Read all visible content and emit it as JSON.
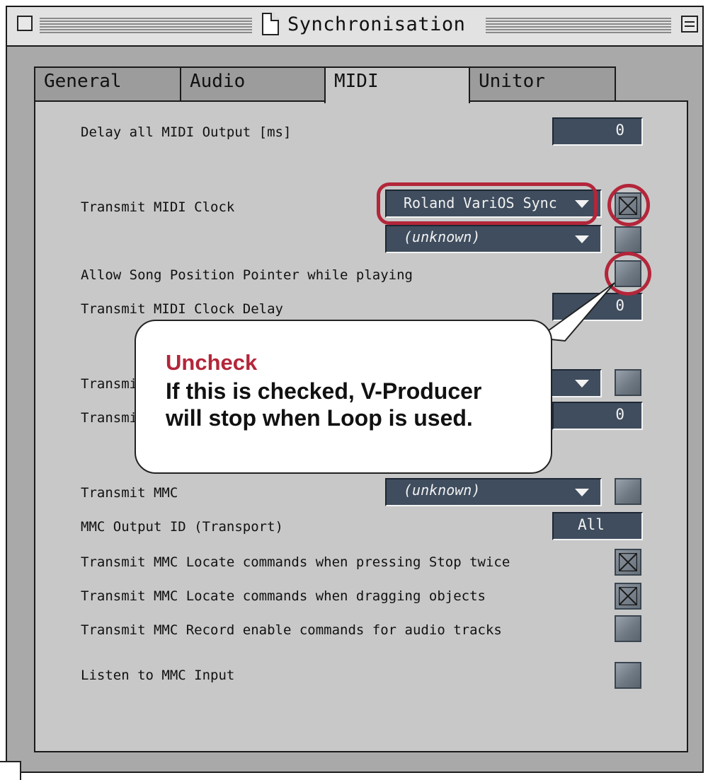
{
  "window": {
    "title": "Synchronisation"
  },
  "tabs": [
    {
      "label": "General",
      "active": false
    },
    {
      "label": "Audio",
      "active": false
    },
    {
      "label": "MIDI",
      "active": true
    },
    {
      "label": "Unitor",
      "active": false
    }
  ],
  "midi": {
    "delay_output": {
      "label": "Delay all MIDI Output [ms]",
      "value": "0"
    },
    "transmit_clock": {
      "label": "Transmit MIDI Clock",
      "port1": "Roland VariOS Sync",
      "port1_checked": true,
      "port2": "(unknown)",
      "port2_checked": false
    },
    "song_position": {
      "label": "Allow Song Position Pointer while playing",
      "checked": true
    },
    "clock_delay": {
      "label": "Transmit MIDI Clock Delay",
      "value": "0"
    },
    "transmit_row_a": {
      "label": "Transmi",
      "checked": false
    },
    "transmit_row_b": {
      "label": "Transmi",
      "value": "0"
    },
    "transmit_mmc": {
      "label": "Transmit MMC",
      "port": "(unknown)",
      "checked": false
    },
    "mmc_output_id": {
      "label": "MMC Output ID (Transport)",
      "value": "All"
    },
    "mmc_locate_stop": {
      "label": "Transmit MMC Locate commands when pressing Stop twice",
      "checked": true
    },
    "mmc_locate_drag": {
      "label": "Transmit MMC Locate commands when dragging objects",
      "checked": true
    },
    "mmc_record_enable": {
      "label": "Transmit MMC Record enable commands for audio tracks",
      "checked": false
    },
    "listen_mmc": {
      "label": "Listen to MMC Input",
      "checked": false
    }
  },
  "callout": {
    "title": "Uncheck",
    "line1": "If this is checked, V-Producer",
    "line2": "will stop when Loop is used."
  },
  "colors": {
    "highlight": "#b3263a",
    "field_bg": "#3f4d5e",
    "panel_bg": "#c8c8c8"
  }
}
